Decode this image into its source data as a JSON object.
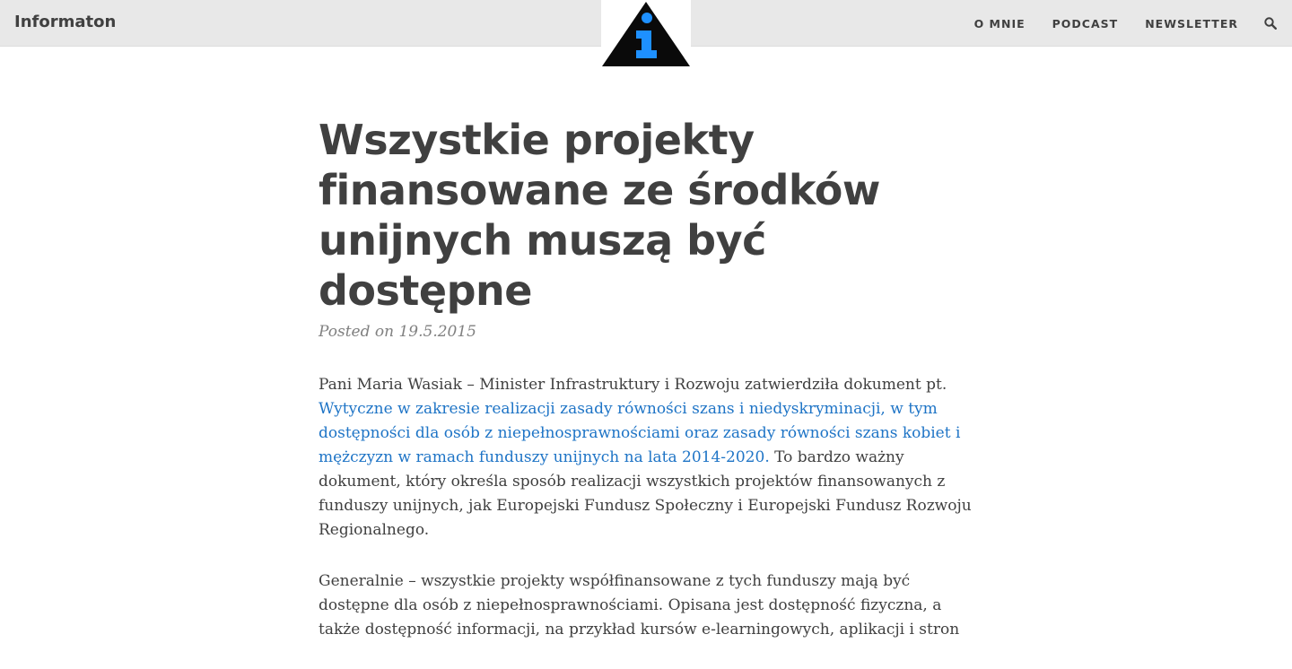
{
  "header": {
    "brand": "Informaton",
    "nav": [
      "O MNIE",
      "PODCAST",
      "NEWSLETTER"
    ],
    "search_icon": "search-icon",
    "logo_icon": "info-triangle-logo"
  },
  "post": {
    "title": "Wszystkie projekty finansowane ze środków unijnych muszą być dostępne",
    "meta": "Posted on 19.5.2015",
    "p1_before": "Pani Maria Wasiak – Minister Infrastruktury i Rozwoju zatwierdziła dokument pt. ",
    "p1_link": "Wytyczne w zakresie realizacji zasady równości szans i niedyskryminacji, w tym dostępności dla osób z niepełnosprawnościami oraz zasady równości szans kobiet i mężczyzn w ramach funduszy unijnych na lata 2014-2020.",
    "p1_after": " To bardzo ważny dokument, który określa sposób realizacji wszystkich projektów finansowanych z funduszy unijnych, jak Europejski Fundusz Społeczny i Europejski Fundusz Rozwoju Regionalnego.",
    "p2": "Generalnie – wszystkie projekty współfinansowane z tych funduszy mają być dostępne dla osób z niepełnosprawnościami. Opisana jest dostępność fizyczna, a także dostępność informacji, na przykład kursów e-learningowych, aplikacji i stron"
  },
  "colors": {
    "navbar_bg": "#e8e8e8",
    "text": "#404040",
    "link": "#1e74c6",
    "logo_blue": "#1e90ff"
  }
}
